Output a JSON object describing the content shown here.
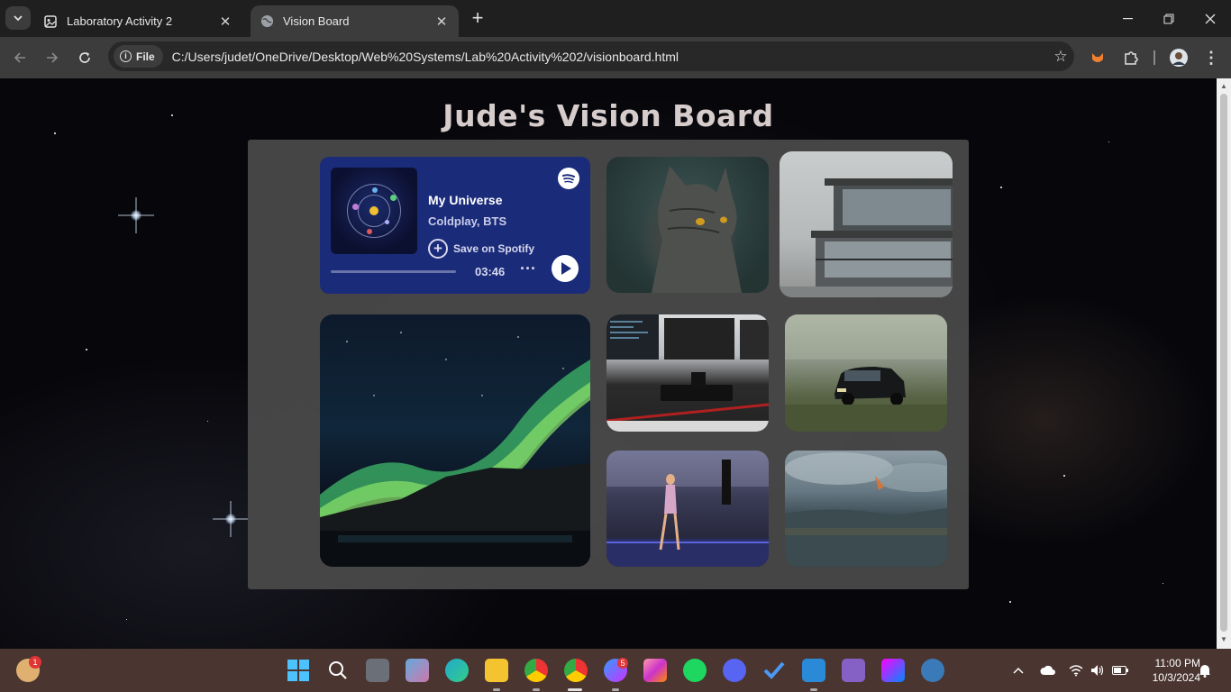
{
  "browser": {
    "tabs": [
      {
        "title": "Laboratory Activity 2"
      },
      {
        "title": "Vision Board"
      }
    ],
    "new_tab_symbol": "+",
    "close_symbol": "✕",
    "chip_label": "File",
    "url": "C:/Users/judet/OneDrive/Desktop/Web%20Systems/Lab%20Activity%202/visionboard.html"
  },
  "page": {
    "title": "Jude's Vision Board",
    "spotify": {
      "song": "My Universe",
      "artist": "Coldplay, BTS",
      "save_label": "Save on Spotify",
      "time": "03:46"
    },
    "photos": [
      "cat",
      "modern-house",
      "aurora",
      "desk-setup",
      "suv-car",
      "concert-stage",
      "crowd-field"
    ]
  },
  "taskbar": {
    "app_badges": {
      "widgets": "1",
      "messenger": "5"
    },
    "clock_time": "11:00 PM",
    "clock_date": "10/3/2024"
  },
  "colors": {
    "spotify_card": "#1a2b7a",
    "board_panel": "#4b4b4b",
    "title_text": "#d6cccc",
    "taskbar": "#4a3530"
  }
}
